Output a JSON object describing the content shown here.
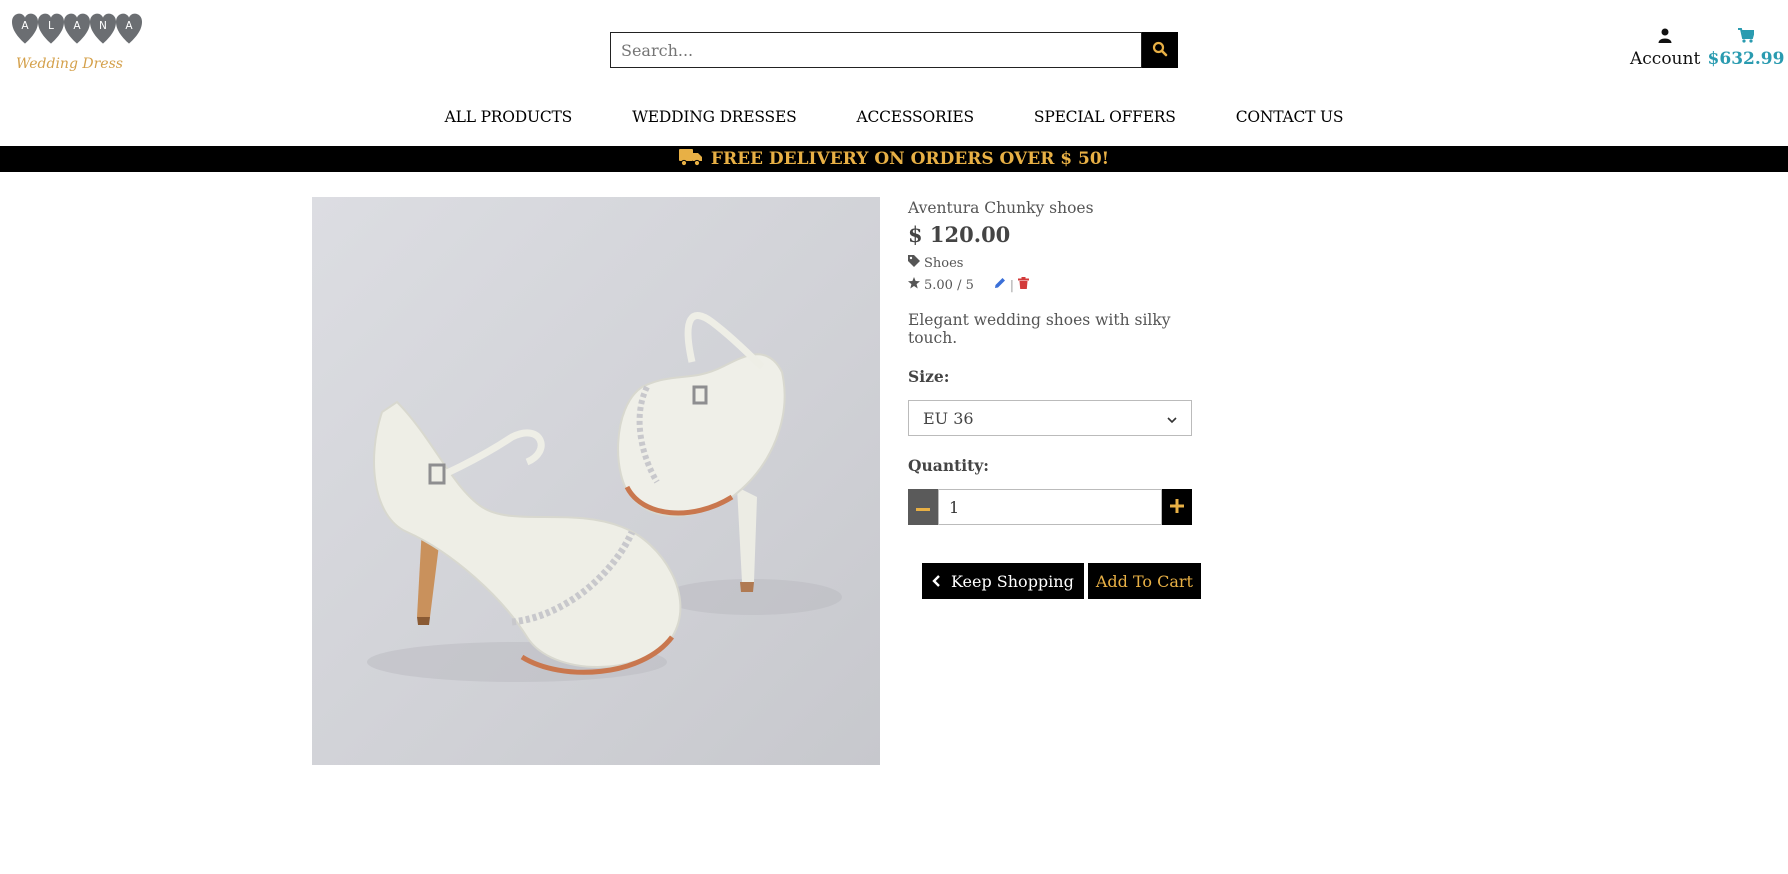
{
  "logo": {
    "letters": [
      "A",
      "L",
      "A",
      "N",
      "A"
    ],
    "subtitle": "Wedding Dress",
    "heart_color": "#6b6e72",
    "subtitle_color": "#d4a04a"
  },
  "search": {
    "placeholder": "Search...",
    "icon": "search-icon"
  },
  "account": {
    "label": "Account",
    "icon": "user-icon"
  },
  "cart": {
    "amount": "$632.99",
    "icon": "shopping-cart-icon",
    "color": "#2a9bb0"
  },
  "nav": {
    "items": [
      "ALL PRODUCTS",
      "WEDDING DRESSES",
      "ACCESSORIES",
      "SPECIAL OFFERS",
      "CONTACT US"
    ]
  },
  "banner": {
    "text": "FREE DELIVERY ON ORDERS OVER $ 50!",
    "icon": "truck-icon",
    "color": "#e8b045"
  },
  "product": {
    "name": "Aventura Chunky shoes",
    "price": "$ 120.00",
    "category": "Shoes",
    "category_icon": "tag-icon",
    "rating": "5.00 / 5",
    "rating_icon": "star-icon",
    "description": "Elegant wedding shoes with silky touch.",
    "size_label": "Size:",
    "size_value": "EU 36",
    "quantity_label": "Quantity:",
    "quantity_value": "1"
  },
  "actions": {
    "keep_shopping": "Keep Shopping",
    "add_to_cart": "Add To Cart"
  }
}
